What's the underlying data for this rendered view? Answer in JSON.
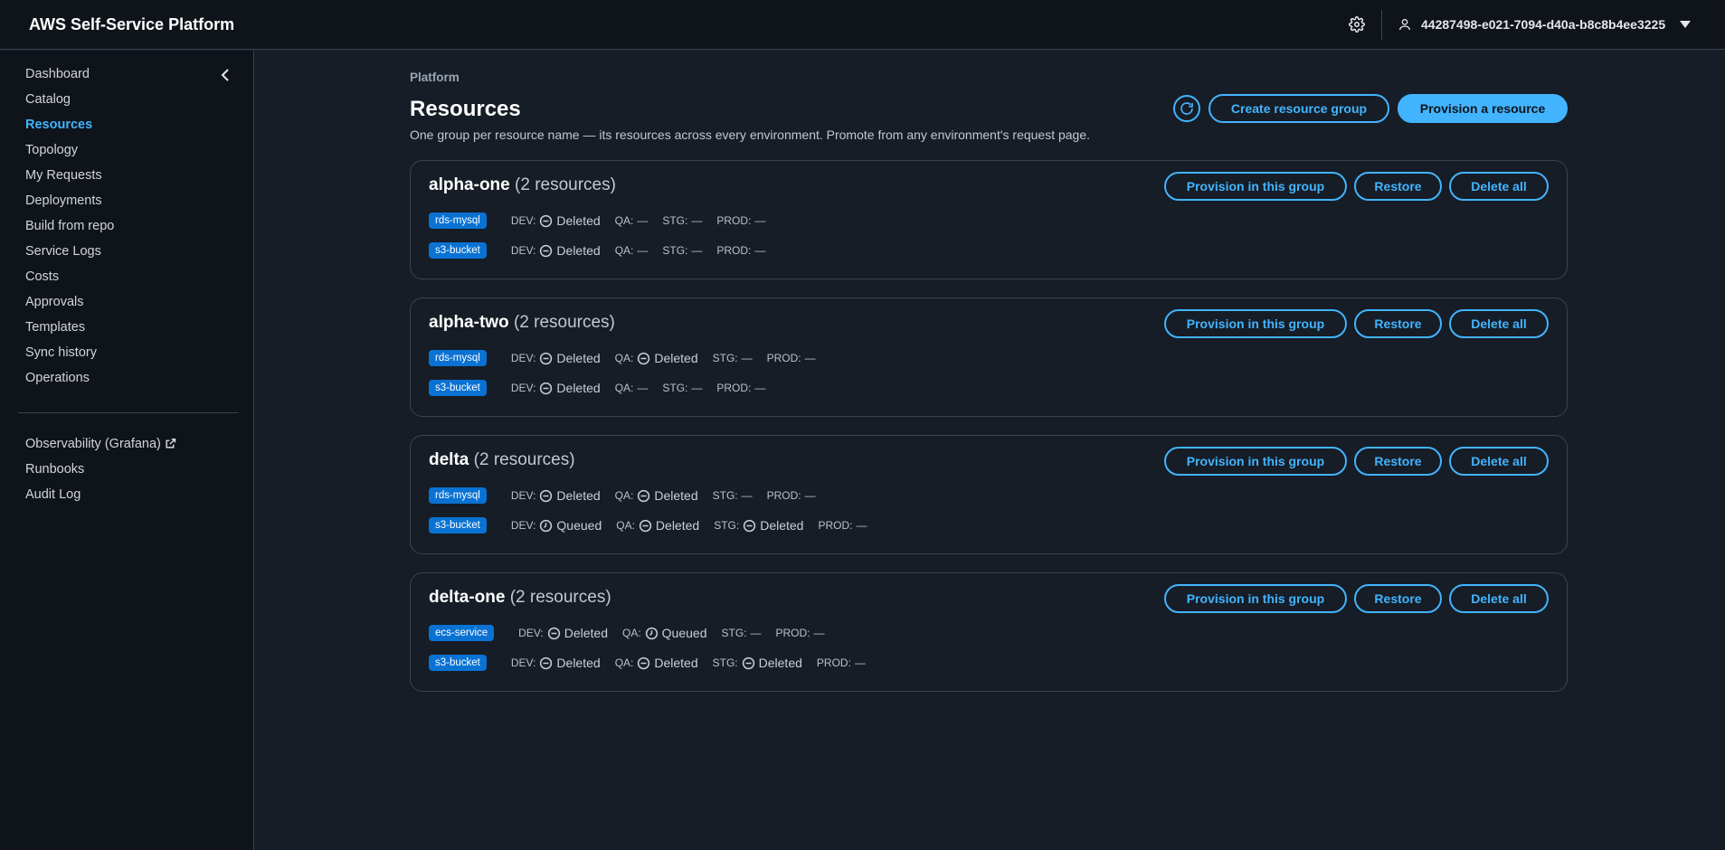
{
  "header": {
    "title": "AWS Self-Service Platform",
    "user": "44287498-e021-7094-d40a-b8c8b4ee3225"
  },
  "sidebar": {
    "items": [
      {
        "label": "Dashboard"
      },
      {
        "label": "Catalog"
      },
      {
        "label": "Resources",
        "active": true
      },
      {
        "label": "Topology"
      },
      {
        "label": "My Requests"
      },
      {
        "label": "Deployments"
      },
      {
        "label": "Build from repo"
      },
      {
        "label": "Service Logs"
      },
      {
        "label": "Costs"
      },
      {
        "label": "Approvals"
      },
      {
        "label": "Templates"
      },
      {
        "label": "Sync history"
      },
      {
        "label": "Operations"
      }
    ],
    "secondary": [
      {
        "label": "Observability (Grafana)"
      },
      {
        "label": "Runbooks"
      },
      {
        "label": "Audit Log"
      }
    ]
  },
  "main": {
    "breadcrumb": "Platform",
    "title": "Resources",
    "description": "One group per resource name — its resources across every environment. Promote from any environment's request page.",
    "create_group_label": "Create resource group",
    "provision_label": "Provision a resource",
    "group_actions": {
      "provision": "Provision in this group",
      "restore": "Restore",
      "delete": "Delete all"
    },
    "groups": [
      {
        "name": "alpha-one",
        "count": "(2 resources)",
        "resources": [
          {
            "type": "rds-mysql",
            "envs": [
              {
                "label": "DEV:",
                "status": "Deleted",
                "icon": "deleted-icon"
              },
              {
                "label": "QA:",
                "status": "—"
              },
              {
                "label": "STG:",
                "status": "—"
              },
              {
                "label": "PROD:",
                "status": "—"
              }
            ]
          },
          {
            "type": "s3-bucket",
            "envs": [
              {
                "label": "DEV:",
                "status": "Deleted",
                "icon": "deleted-icon"
              },
              {
                "label": "QA:",
                "status": "—"
              },
              {
                "label": "STG:",
                "status": "—"
              },
              {
                "label": "PROD:",
                "status": "—"
              }
            ]
          }
        ]
      },
      {
        "name": "alpha-two",
        "count": "(2 resources)",
        "resources": [
          {
            "type": "rds-mysql",
            "envs": [
              {
                "label": "DEV:",
                "status": "Deleted",
                "icon": "deleted-icon"
              },
              {
                "label": "QA:",
                "status": "Deleted",
                "icon": "deleted-icon"
              },
              {
                "label": "STG:",
                "status": "—"
              },
              {
                "label": "PROD:",
                "status": "—"
              }
            ]
          },
          {
            "type": "s3-bucket",
            "envs": [
              {
                "label": "DEV:",
                "status": "Deleted",
                "icon": "deleted-icon"
              },
              {
                "label": "QA:",
                "status": "—"
              },
              {
                "label": "STG:",
                "status": "—"
              },
              {
                "label": "PROD:",
                "status": "—"
              }
            ]
          }
        ]
      },
      {
        "name": "delta",
        "count": "(2 resources)",
        "resources": [
          {
            "type": "rds-mysql",
            "envs": [
              {
                "label": "DEV:",
                "status": "Deleted",
                "icon": "deleted-icon"
              },
              {
                "label": "QA:",
                "status": "Deleted",
                "icon": "deleted-icon"
              },
              {
                "label": "STG:",
                "status": "—"
              },
              {
                "label": "PROD:",
                "status": "—"
              }
            ]
          },
          {
            "type": "s3-bucket",
            "envs": [
              {
                "label": "DEV:",
                "status": "Queued",
                "icon": "queued-icon"
              },
              {
                "label": "QA:",
                "status": "Deleted",
                "icon": "deleted-icon"
              },
              {
                "label": "STG:",
                "status": "Deleted",
                "icon": "deleted-icon"
              },
              {
                "label": "PROD:",
                "status": "—"
              }
            ]
          }
        ]
      },
      {
        "name": "delta-one",
        "count": "(2 resources)",
        "resources": [
          {
            "type": "ecs-service",
            "envs": [
              {
                "label": "DEV:",
                "status": "Deleted",
                "icon": "deleted-icon"
              },
              {
                "label": "QA:",
                "status": "Queued",
                "icon": "queued-icon"
              },
              {
                "label": "STG:",
                "status": "—"
              },
              {
                "label": "PROD:",
                "status": "—"
              }
            ]
          },
          {
            "type": "s3-bucket",
            "envs": [
              {
                "label": "DEV:",
                "status": "Deleted",
                "icon": "deleted-icon"
              },
              {
                "label": "QA:",
                "status": "Deleted",
                "icon": "deleted-icon"
              },
              {
                "label": "STG:",
                "status": "Deleted",
                "icon": "deleted-icon"
              },
              {
                "label": "PROD:",
                "status": "—"
              }
            ]
          }
        ]
      }
    ]
  },
  "colors": {
    "accent": "#42b4ff",
    "badge": "#0972d3",
    "background": "#161d26",
    "chrome": "#0f141a",
    "border": "#3a4350"
  }
}
